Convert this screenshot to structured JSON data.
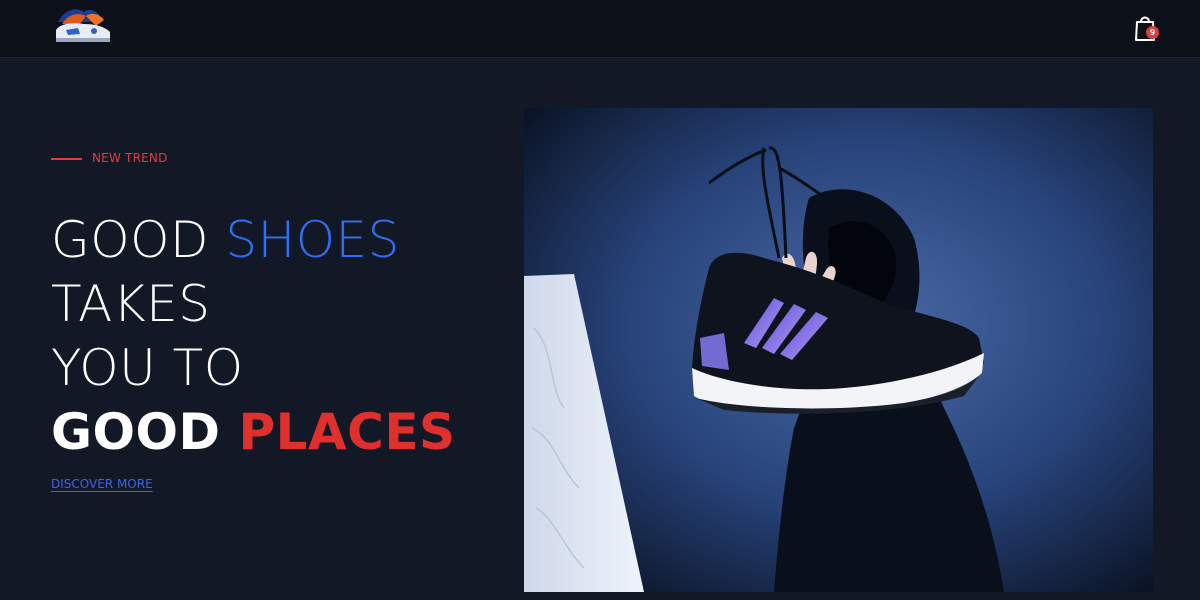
{
  "header": {
    "logo_icon": "sneaker-logo-icon",
    "cart_icon": "shopping-bag-icon",
    "cart_count": "9"
  },
  "hero": {
    "eyebrow": "NEW TREND",
    "headline": {
      "l1_a": "GOOD ",
      "l1_b": "SHOES",
      "l2": "TAKES",
      "l3": "YOU TO",
      "l4_a": "GOOD ",
      "l4_b": "PLACES"
    },
    "cta": "DISCOVER MORE",
    "image_icon": "sneaker-photo"
  },
  "colors": {
    "background": "#131826",
    "topbar": "#0c1018",
    "accent_blue": "#2f6ef0",
    "accent_red": "#e0302e"
  }
}
